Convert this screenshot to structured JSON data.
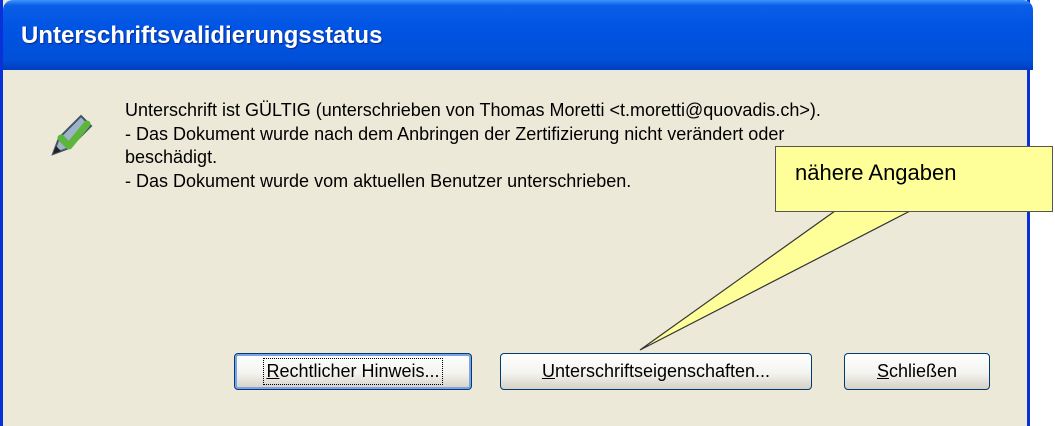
{
  "window": {
    "title": "Unterschriftsvalidierungsstatus"
  },
  "message": {
    "icon": "signature-pen-check-icon",
    "lines": [
      "Unterschrift ist GÜLTIG (unterschrieben von Thomas Moretti <t.moretti@quovadis.ch>).",
      "- Das Dokument wurde nach dem Anbringen der Zertifizierung nicht verändert oder",
      "beschädigt.",
      "- Das Dokument wurde vom aktuellen Benutzer unterschrieben."
    ]
  },
  "buttons": {
    "legal": {
      "mnemonic": "R",
      "rest": "echtlicher Hinweis..."
    },
    "properties": {
      "mnemonic": "U",
      "rest": "nterschriftseigenschaften..."
    },
    "close": {
      "mnemonic": "S",
      "rest": "chließen"
    }
  },
  "callout": {
    "text": "nähere Angaben"
  },
  "colors": {
    "titlebar": "#0054e3",
    "dialog": "#ece9d8",
    "callout": "#ffff99",
    "check": "#6cc04a"
  }
}
